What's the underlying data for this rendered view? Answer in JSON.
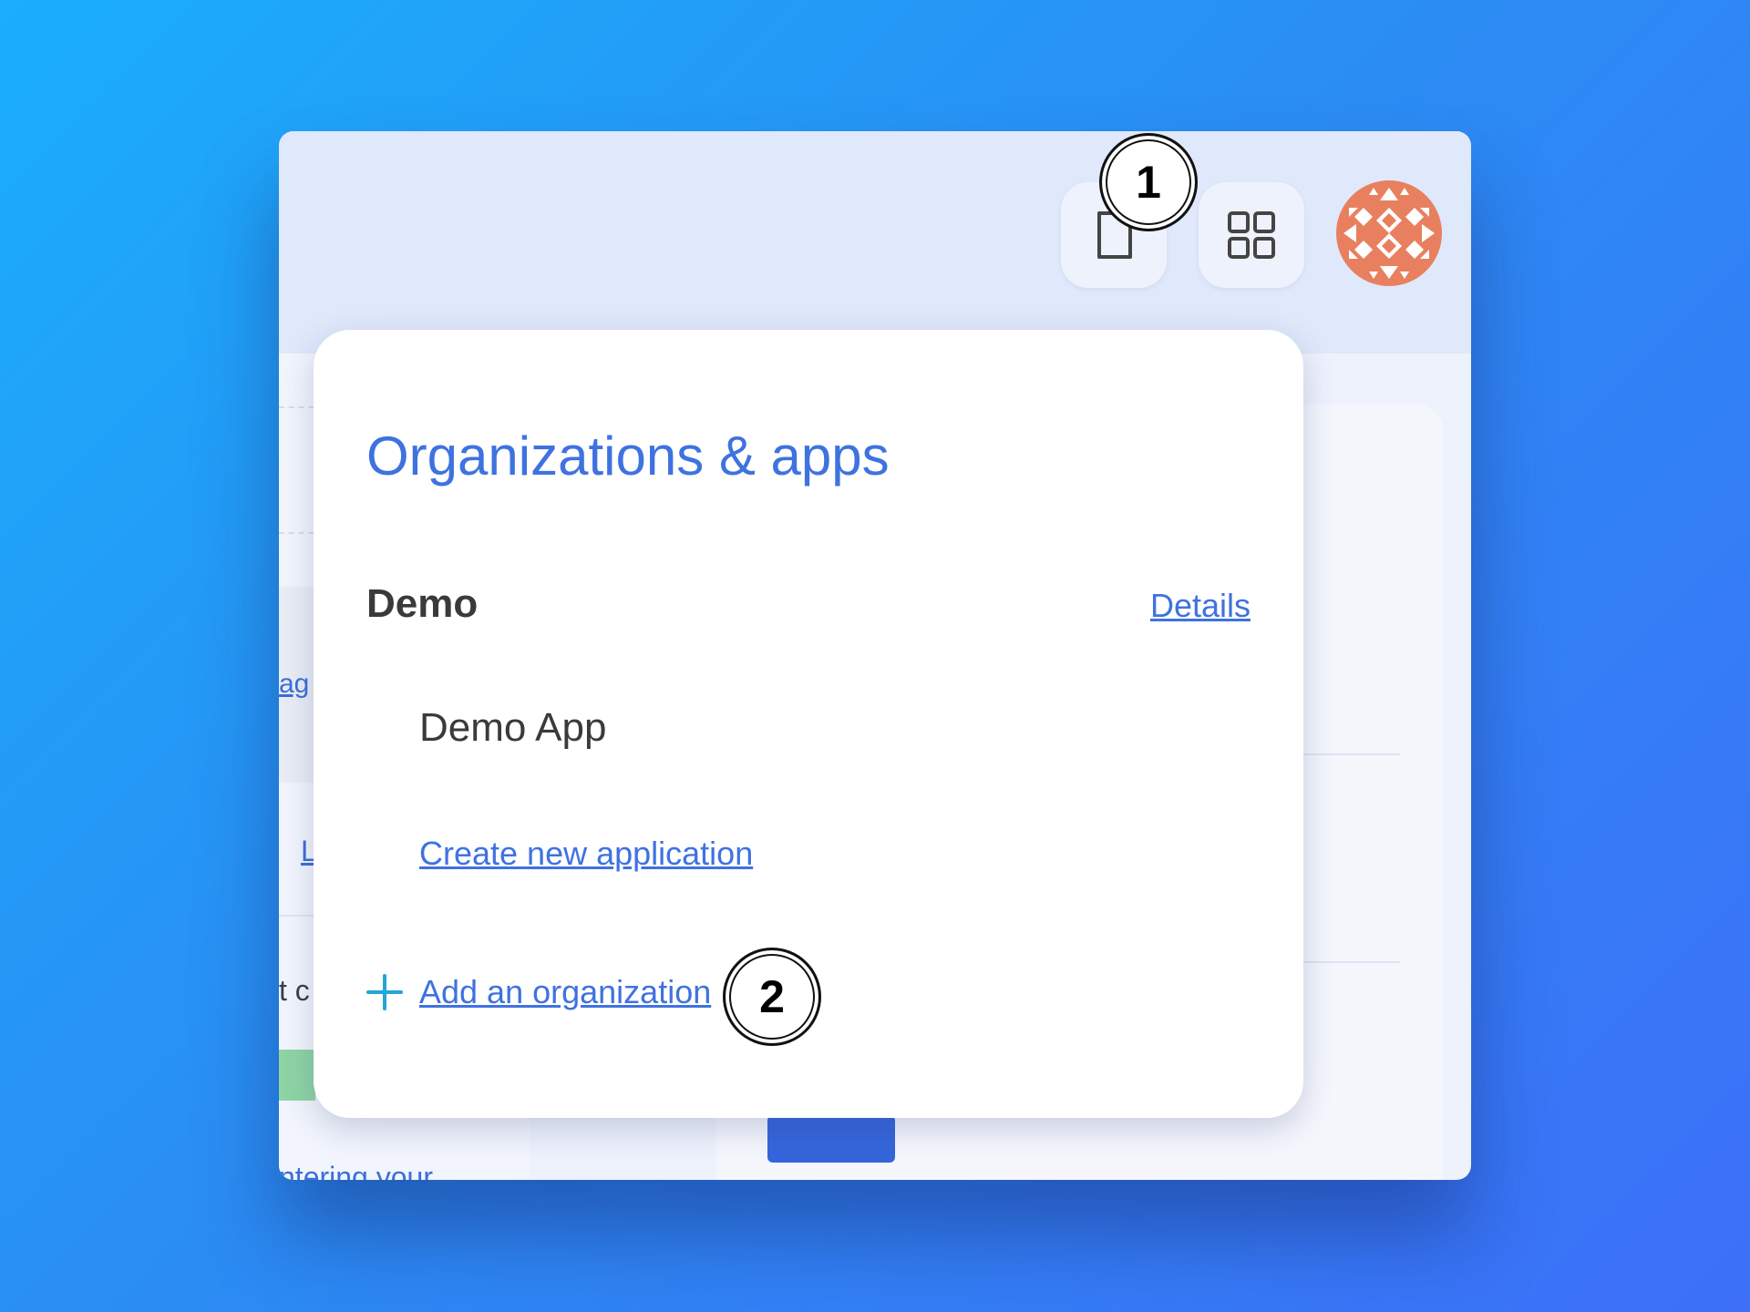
{
  "topbar": {
    "icons": [
      "document-icon",
      "grid-icon"
    ],
    "avatar": "avatar"
  },
  "background": {
    "left_link_a": "ag",
    "left_link_b": "L",
    "left_text_c": "t c",
    "left_text_d": "ntering your"
  },
  "panel": {
    "title": "Organizations & apps",
    "organization": {
      "name": "Demo",
      "details_link": "Details",
      "apps": [
        "Demo App"
      ],
      "create_app_link": "Create new application"
    },
    "add_organization_label": "Add an organization"
  },
  "annotations": {
    "step1": "1",
    "step2": "2"
  },
  "colors": {
    "accent": "#3f72e0",
    "plus": "#21a7d8",
    "avatar": "#e8805f"
  }
}
